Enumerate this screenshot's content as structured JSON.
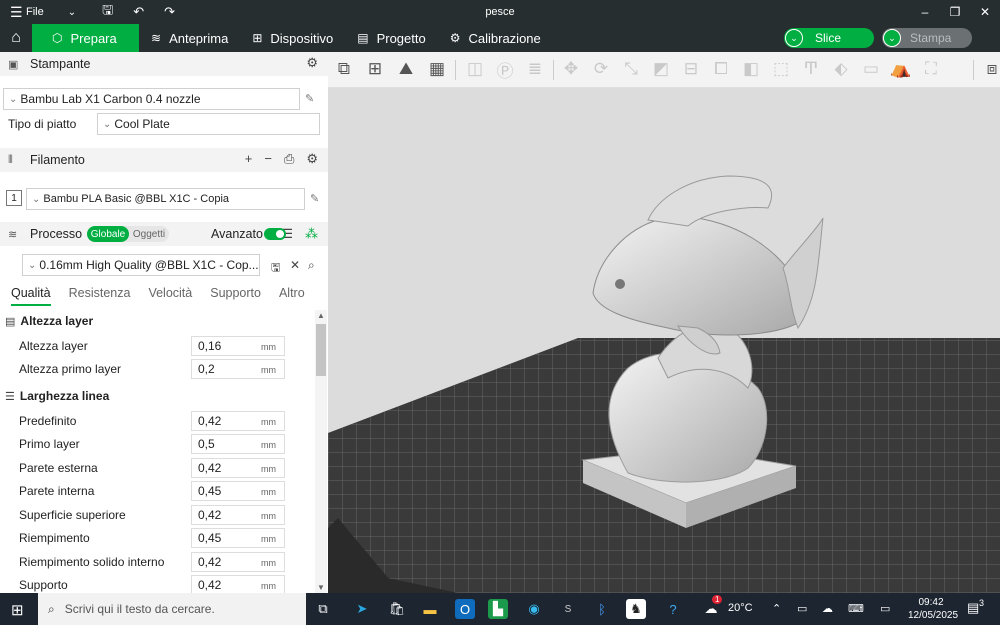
{
  "titlebar": {
    "menu_label": "File",
    "title": "pesce"
  },
  "nav": {
    "tabs": [
      {
        "label": "Prepara"
      },
      {
        "label": "Anteprima"
      },
      {
        "label": "Dispositivo"
      },
      {
        "label": "Progetto"
      },
      {
        "label": "Calibrazione"
      }
    ],
    "slice_label": "Slice",
    "print_label": "Stampa"
  },
  "printer": {
    "section_title": "Stampante",
    "printer_name": "Bambu Lab X1 Carbon 0.4 nozzle",
    "plate_label": "Tipo di piatto",
    "plate_value": "Cool Plate"
  },
  "filament": {
    "section_title": "Filamento",
    "slot_number": "1",
    "filament_name": "Bambu PLA Basic @BBL X1C - Copia"
  },
  "process": {
    "section_title": "Processo",
    "scope_global": "Globale",
    "scope_objects": "Oggetti",
    "advanced_label": "Avanzato",
    "profile_name": "0.16mm High Quality @BBL X1C - Cop...",
    "subtabs": [
      "Qualità",
      "Resistenza",
      "Velocità",
      "Supporto",
      "Altro"
    ]
  },
  "groups": [
    {
      "title": "Altezza layer",
      "rows": [
        {
          "label": "Altezza layer",
          "value": "0,16",
          "unit": "mm"
        },
        {
          "label": "Altezza primo layer",
          "value": "0,2",
          "unit": "mm"
        }
      ]
    },
    {
      "title": "Larghezza linea",
      "rows": [
        {
          "label": "Predefinito",
          "value": "0,42",
          "unit": "mm"
        },
        {
          "label": "Primo layer",
          "value": "0,5",
          "unit": "mm"
        },
        {
          "label": "Parete esterna",
          "value": "0,42",
          "unit": "mm"
        },
        {
          "label": "Parete interna",
          "value": "0,45",
          "unit": "mm"
        },
        {
          "label": "Superficie superiore",
          "value": "0,42",
          "unit": "mm"
        },
        {
          "label": "Riempimento",
          "value": "0,45",
          "unit": "mm"
        },
        {
          "label": "Riempimento solido interno",
          "value": "0,42",
          "unit": "mm"
        },
        {
          "label": "Supporto",
          "value": "0,42",
          "unit": "mm"
        }
      ]
    }
  ],
  "taskbar": {
    "search_placeholder": "Scrivi qui il testo da cercare.",
    "weather": "20°C",
    "time": "09:42",
    "date": "12/05/2025",
    "mail_badge": "1",
    "notif_count": "3"
  },
  "colors": {
    "accent": "#00ae42",
    "dark": "#262e30"
  }
}
